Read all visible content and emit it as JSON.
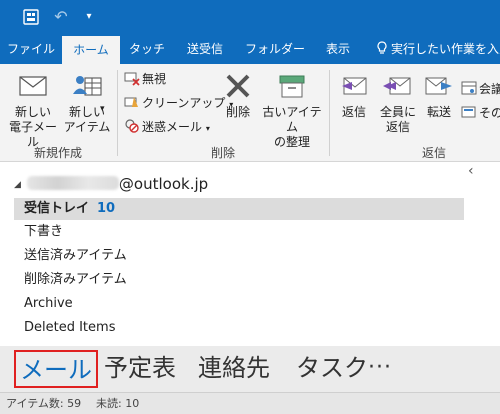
{
  "tabs": [
    {
      "label": "ファイル",
      "active": false
    },
    {
      "label": "ホーム",
      "active": true
    },
    {
      "label": "タッチ",
      "active": false
    },
    {
      "label": "送受信",
      "active": false
    },
    {
      "label": "フォルダー",
      "active": false
    },
    {
      "label": "表示",
      "active": false
    }
  ],
  "tell_me": "実行したい作業を入力",
  "ribbon": {
    "new_mail": [
      "新しい",
      "電子メール"
    ],
    "new_items": [
      "新しい",
      "アイテム"
    ],
    "group_new": "新規作成",
    "ignore": "無視",
    "cleanup": "クリーンアップ",
    "junk": "迷惑メール",
    "delete": "削除",
    "archive_old": [
      "古いアイテム",
      "の整理"
    ],
    "group_delete": "削除",
    "reply": "返信",
    "reply_all": [
      "全員に",
      "返信"
    ],
    "forward": "転送",
    "meeting": "会議",
    "other": "その",
    "group_respond": "返信"
  },
  "account": {
    "domain": "@outlook.jp"
  },
  "folders": [
    {
      "label": "受信トレイ",
      "count": "10",
      "selected": true
    },
    {
      "label": "下書き"
    },
    {
      "label": "送信済みアイテム"
    },
    {
      "label": "削除済みアイテム"
    },
    {
      "label": "Archive"
    },
    {
      "label": "Deleted Items"
    }
  ],
  "nav": {
    "mail": "メール",
    "calendar": "予定表",
    "people": "連絡先",
    "tasks": "タスク",
    "more": "···"
  },
  "status": {
    "items": "アイテム数: 59",
    "unread": "未読: 10"
  },
  "colors": {
    "accent": "#0f6cbd",
    "highlight_border": "#e02020"
  }
}
